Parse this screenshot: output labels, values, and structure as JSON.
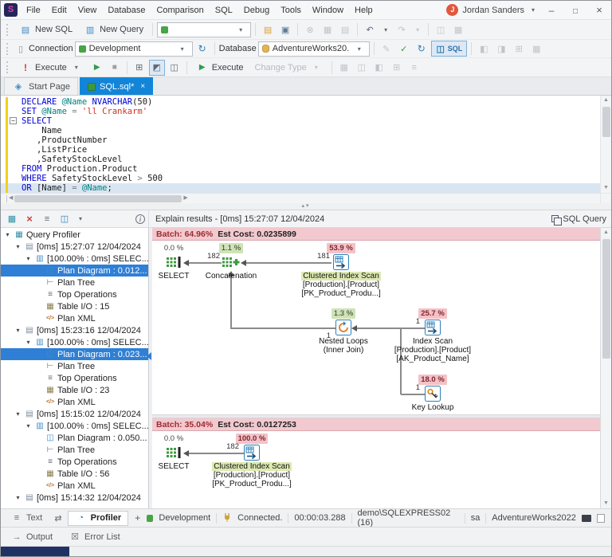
{
  "titlebar": {
    "logo": "S",
    "menus": [
      "File",
      "Edit",
      "View",
      "Database",
      "Comparison",
      "SQL",
      "Debug",
      "Tools",
      "Window",
      "Help"
    ],
    "user_name": "Jordan Sanders"
  },
  "toolbar_a": {
    "new_sql": "New SQL",
    "new_query": "New Query"
  },
  "toolbar_b": {
    "connection_label": "Connection",
    "connection_value": "Development",
    "database_label": "Database",
    "database_value": "AdventureWorks20...",
    "sql_toggle": "SQL"
  },
  "toolbar_c": {
    "execute": "Execute",
    "execute2": "Execute",
    "change_type": "Change Type"
  },
  "doc_tabs": {
    "start_page": "Start Page",
    "sql_tab": "SQL.sql*"
  },
  "editor": {
    "lines": [
      {
        "tokens": [
          {
            "t": "DECLARE ",
            "c": "kw"
          },
          {
            "t": "@Name ",
            "c": "var"
          },
          {
            "t": "NVARCHAR",
            "c": "kw"
          },
          {
            "t": "(50)",
            "c": "pl"
          }
        ]
      },
      {
        "tokens": [
          {
            "t": "SET ",
            "c": "kw"
          },
          {
            "t": "@Name ",
            "c": "var"
          },
          {
            "t": "= ",
            "c": "op"
          },
          {
            "t": "'ll Crankarm'",
            "c": "str"
          }
        ]
      },
      {
        "fold": true,
        "tokens": [
          {
            "t": "SELECT",
            "c": "kw"
          }
        ]
      },
      {
        "tokens": [
          {
            "t": "    Name",
            "c": "pl"
          }
        ]
      },
      {
        "tokens": [
          {
            "t": "   ,ProductNumber",
            "c": "pl"
          }
        ]
      },
      {
        "tokens": [
          {
            "t": "   ,ListPrice",
            "c": "pl"
          }
        ]
      },
      {
        "tokens": [
          {
            "t": "   ,SafetyStockLevel",
            "c": "pl"
          }
        ]
      },
      {
        "tokens": [
          {
            "t": "FROM ",
            "c": "kw"
          },
          {
            "t": "Production.Product",
            "c": "pl"
          }
        ]
      },
      {
        "tokens": [
          {
            "t": "WHERE ",
            "c": "kw"
          },
          {
            "t": "SafetyStockLevel ",
            "c": "pl"
          },
          {
            "t": "> ",
            "c": "op"
          },
          {
            "t": "500",
            "c": "pl"
          }
        ]
      },
      {
        "hl": true,
        "tokens": [
          {
            "t": "OR ",
            "c": "kw"
          },
          {
            "t": "[Name] ",
            "c": "pl"
          },
          {
            "t": "= ",
            "c": "op"
          },
          {
            "t": "@Name",
            "c": "var"
          },
          {
            "t": ";",
            "c": "pl"
          }
        ]
      }
    ]
  },
  "profiler_toolbar": {
    "explain_header": "Explain results - [0ms] 15:27:07 12/04/2024",
    "corner": "SQL Query"
  },
  "profiler_tree": [
    {
      "lv": 0,
      "exp": "exp",
      "icon": "profiler",
      "label": "Query Profiler"
    },
    {
      "lv": 1,
      "exp": "exp",
      "icon": "session",
      "label": "[0ms] 15:27:07 12/04/2024"
    },
    {
      "lv": 2,
      "exp": "exp",
      "icon": "sql",
      "label": "[100.00% : 0ms] SELEC..."
    },
    {
      "lv": 3,
      "icon": "diagram",
      "label": "Plan Diagram : 0.012...",
      "sel": true
    },
    {
      "lv": 3,
      "icon": "plantree",
      "label": "Plan Tree"
    },
    {
      "lv": 3,
      "icon": "topops",
      "label": "Top Operations"
    },
    {
      "lv": 3,
      "icon": "tableio",
      "label": "Table I/O : 15"
    },
    {
      "lv": 3,
      "icon": "xml",
      "label": "Plan XML"
    },
    {
      "lv": 1,
      "exp": "exp",
      "icon": "session",
      "label": "[0ms] 15:23:16 12/04/2024"
    },
    {
      "lv": 2,
      "exp": "exp",
      "icon": "sql",
      "label": "[100.00% : 0ms] SELEC..."
    },
    {
      "lv": 3,
      "icon": "diagram",
      "label": "Plan Diagram : 0.023...",
      "sel": true
    },
    {
      "lv": 3,
      "icon": "plantree",
      "label": "Plan Tree"
    },
    {
      "lv": 3,
      "icon": "topops",
      "label": "Top Operations"
    },
    {
      "lv": 3,
      "icon": "tableio",
      "label": "Table I/O : 23"
    },
    {
      "lv": 3,
      "icon": "xml",
      "label": "Plan XML"
    },
    {
      "lv": 1,
      "exp": "exp",
      "icon": "session",
      "label": "[0ms] 15:15:02 12/04/2024"
    },
    {
      "lv": 2,
      "exp": "exp",
      "icon": "sql",
      "label": "[100.00% : 0ms] SELEC..."
    },
    {
      "lv": 3,
      "icon": "diagram",
      "label": "Plan Diagram : 0.050..."
    },
    {
      "lv": 3,
      "icon": "plantree",
      "label": "Plan Tree"
    },
    {
      "lv": 3,
      "icon": "topops",
      "label": "Top Operations"
    },
    {
      "lv": 3,
      "icon": "tableio",
      "label": "Table I/O : 56"
    },
    {
      "lv": 3,
      "icon": "xml",
      "label": "Plan XML"
    },
    {
      "lv": 1,
      "exp": "exp",
      "icon": "session",
      "label": "[0ms] 15:14:32 12/04/2024"
    }
  ],
  "explain": {
    "batches": [
      {
        "batch_label": "Batch: 64.96%",
        "cost_label": "Est Cost: 0.0235899",
        "nodes": [
          {
            "id": "select",
            "icon": "select",
            "pct": "0.0 %",
            "lvl": "plain",
            "name": [
              "SELECT"
            ]
          },
          {
            "id": "concatenation",
            "icon": "concat",
            "pct": "1.1 %",
            "lvl": "low",
            "rows": "182",
            "name": [
              "Concatenation"
            ]
          },
          {
            "id": "clustered-index-scan",
            "icon": "scan",
            "pct": "53.9 %",
            "lvl": "high",
            "rows": "181",
            "hl": true,
            "name": [
              "Clustered Index Scan",
              "[Production].[Product]",
              "[PK_Product_Produ...]"
            ]
          },
          {
            "id": "nested-loops",
            "icon": "loop",
            "pct": "1.3 %",
            "lvl": "low",
            "rows": "1",
            "name": [
              "Nested Loops",
              "(Inner Join)"
            ]
          },
          {
            "id": "index-scan",
            "icon": "scan",
            "pct": "25.7 %",
            "lvl": "high",
            "rows": "1",
            "name": [
              "Index Scan",
              "[Production].[Product]",
              "[AK_Product_Name]"
            ]
          },
          {
            "id": "key-lookup",
            "icon": "key",
            "pct": "18.0 %",
            "lvl": "high",
            "rows": "1",
            "name": [
              "Key Lookup"
            ]
          }
        ]
      },
      {
        "batch_label": "Batch: 35.04%",
        "cost_label": "Est Cost: 0.0127253",
        "nodes": [
          {
            "id": "select-2",
            "icon": "select",
            "pct": "0.0 %",
            "lvl": "plain",
            "name": [
              "SELECT"
            ]
          },
          {
            "id": "clustered-index-scan-2",
            "icon": "scan",
            "pct": "100.0 %",
            "lvl": "high",
            "rows": "182",
            "hl": true,
            "name": [
              "Clustered Index Scan",
              "[Production].[Product]",
              "[PK_Product_Produ...]"
            ]
          }
        ]
      }
    ]
  },
  "status_tabs": {
    "text": "Text",
    "profiler": "Profiler",
    "plus": "+"
  },
  "statusbar": {
    "env": "Development",
    "connected": "Connected.",
    "elapsed": "00:00:03.288",
    "server": "demo\\SQLEXPRESS02 (16)",
    "user": "sa",
    "database": "AdventureWorks2022"
  },
  "dock_tabs": {
    "output": "Output",
    "error_list": "Error List"
  }
}
